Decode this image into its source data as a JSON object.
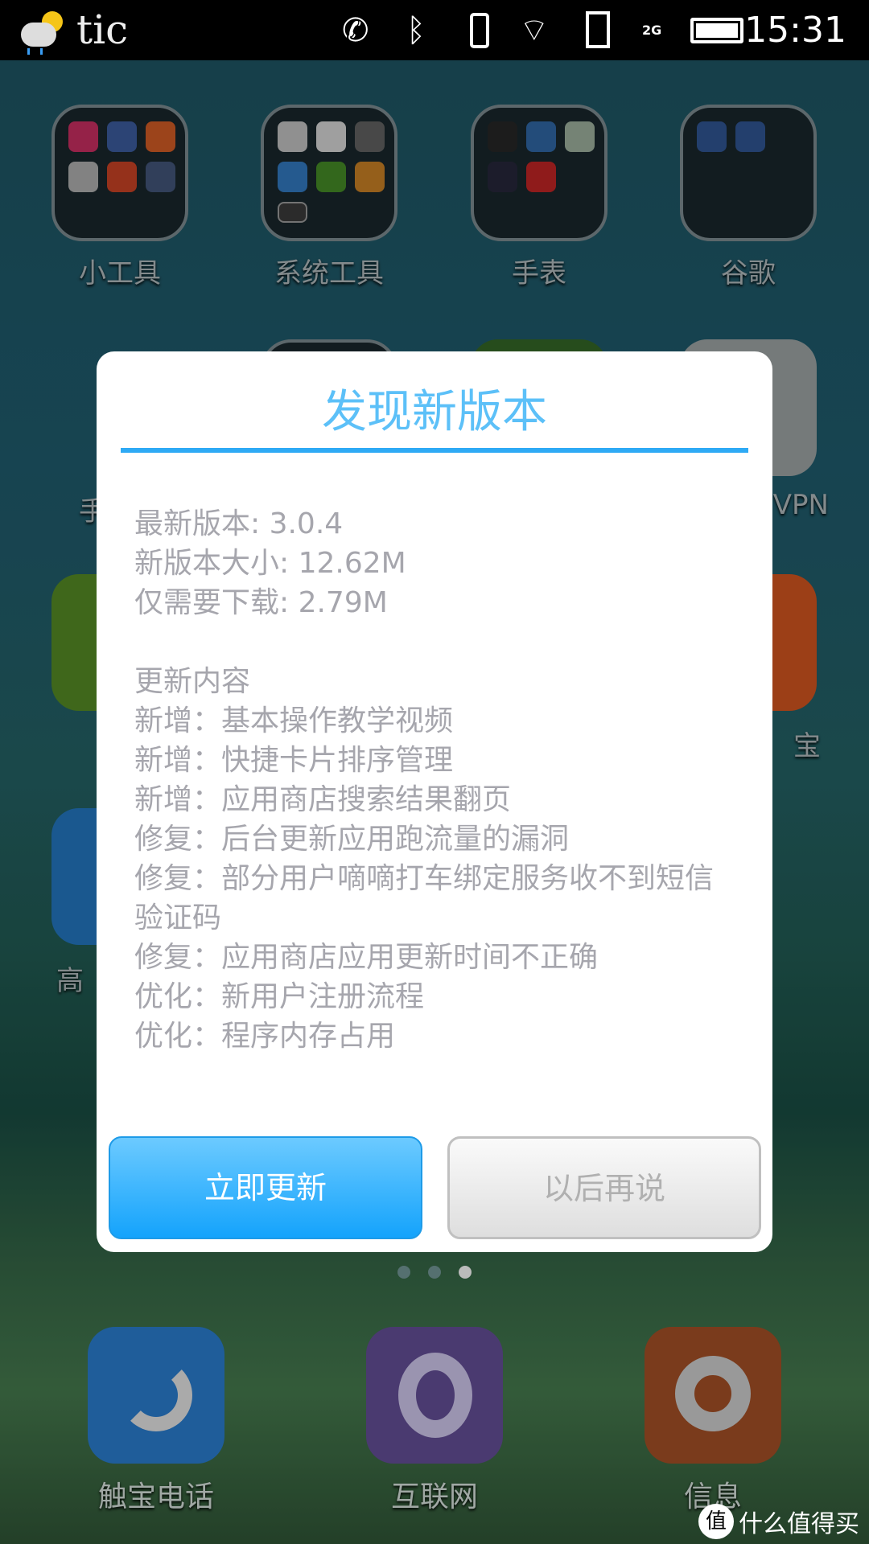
{
  "status_bar": {
    "app_name": "tic",
    "time": "15:31",
    "network": "2G",
    "icons": [
      "weather-icon",
      "phone-call-icon",
      "bluetooth-icon",
      "vibrate-icon",
      "wifi-icon",
      "sim-alert-icon",
      "signal-icon",
      "battery-icon"
    ]
  },
  "home": {
    "folders": [
      {
        "label": "小工具"
      },
      {
        "label": "系统工具"
      },
      {
        "label": "手表"
      },
      {
        "label": "谷歌"
      }
    ],
    "partial_labels": {
      "row2_col1": "手",
      "row2_col4": "VPN",
      "row3_col4": "宝",
      "row4_col1": "高"
    },
    "page_indicator": {
      "pages": 3,
      "current": 3
    },
    "dock": [
      {
        "label": "触宝电话",
        "color": "#1f5d9a"
      },
      {
        "label": "互联网",
        "color": "#4a3a70"
      },
      {
        "label": "信息",
        "color": "#7a3b1c"
      }
    ]
  },
  "dialog": {
    "title": "发现新版本",
    "info": [
      "最新版本: 3.0.4",
      "新版本大小: 12.62M",
      "仅需要下载: 2.79M"
    ],
    "changelog_heading": "更新内容",
    "changelog": [
      "新增：基本操作教学视频",
      "新增：快捷卡片排序管理",
      "新增：应用商店搜索结果翻页",
      "修复：后台更新应用跑流量的漏洞",
      "修复：部分用户嘀嘀打车绑定服务收不到短信验证码",
      "修复：应用商店应用更新时间不正确",
      "优化：新用户注册流程",
      "优化：程序内存占用"
    ],
    "update_button": "立即更新",
    "later_button": "以后再说",
    "accent_color": "#2eaaf5"
  },
  "watermark": {
    "badge": "值",
    "text": "什么值得买"
  }
}
